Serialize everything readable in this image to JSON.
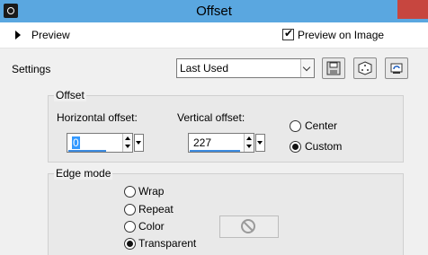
{
  "window": {
    "title": "Offset"
  },
  "preview": {
    "label": "Preview",
    "preview_on_image_label": "Preview on Image",
    "preview_on_image_checked": true
  },
  "settings": {
    "label": "Settings",
    "preset_value": "Last Used"
  },
  "offset_group": {
    "label": "Offset",
    "horizontal_label": "Horizontal offset:",
    "horizontal_value": "0",
    "vertical_label": "Vertical offset:",
    "vertical_value": "227",
    "radios": [
      {
        "label": "Center",
        "checked": false
      },
      {
        "label": "Custom",
        "checked": true
      }
    ]
  },
  "edge_mode_group": {
    "label": "Edge mode",
    "radios": [
      {
        "label": "Wrap",
        "checked": false
      },
      {
        "label": "Repeat",
        "checked": false
      },
      {
        "label": "Color",
        "checked": false
      },
      {
        "label": "Transparent",
        "checked": true
      }
    ]
  },
  "icons": {
    "app": "app-icon",
    "save": "save-icon",
    "randomize": "dice-icon",
    "reset": "reset-icon",
    "color_disabled": "no-color-icon"
  },
  "colors": {
    "titlebar": "#5aa7e0",
    "close": "#c7463f",
    "selection": "#3399ff"
  }
}
